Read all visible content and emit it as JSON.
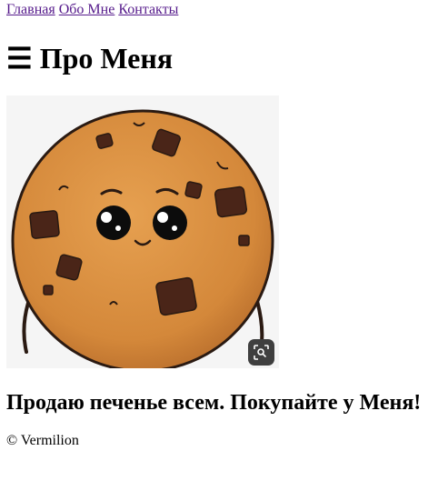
{
  "nav": {
    "items": [
      {
        "label": "Главная"
      },
      {
        "label": "Обо Мне"
      },
      {
        "label": "Контакты"
      }
    ]
  },
  "header": {
    "menu_icon": "☰",
    "title": "Про Меня"
  },
  "hero_image": {
    "subject": "cookie-character",
    "lens_icon": "image-search-icon"
  },
  "main": {
    "tagline": "Продаю печенье всем. Покупайте у Меня!"
  },
  "footer": {
    "copyright": "© Vermilion"
  },
  "colors": {
    "link": "#551a8b",
    "cookie": "#d4883a",
    "chocolate": "#4a2518",
    "lens_button": "#3f3f3f"
  }
}
